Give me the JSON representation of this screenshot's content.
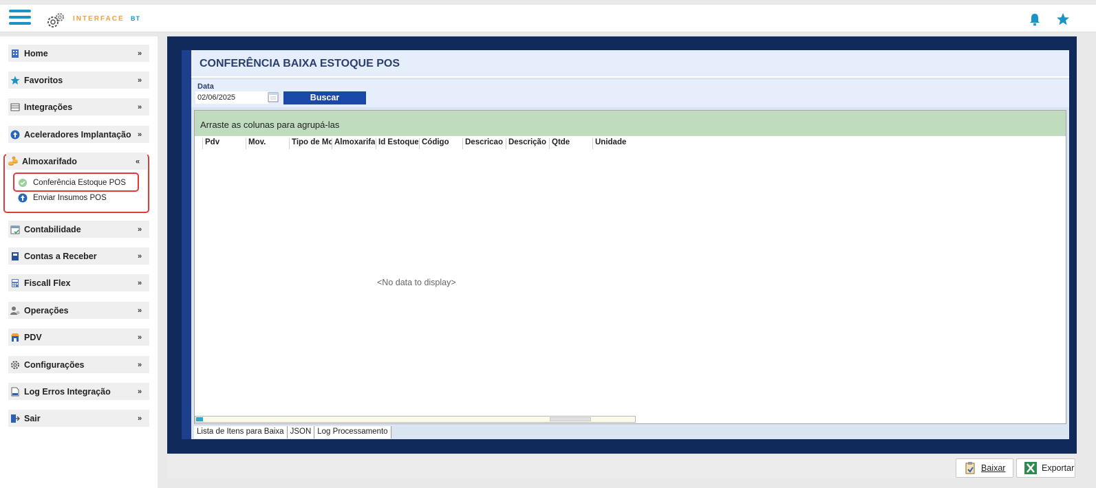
{
  "app": {
    "logo_text": "INTERFACE",
    "logo_suffix": "BT"
  },
  "sidebar": {
    "items": [
      {
        "label": "Home",
        "icon": "building-icon",
        "chevron": "double-chevron-down"
      },
      {
        "label": "Favoritos",
        "icon": "star-icon",
        "chevron": "double-chevron-down"
      },
      {
        "label": "Integrações",
        "icon": "table-icon",
        "chevron": "double-chevron-down"
      },
      {
        "label": "Aceleradores Implantação",
        "icon": "arrow-up-circle-icon",
        "chevron": "double-chevron-down"
      },
      {
        "label": "Almoxarifado",
        "icon": "coins-icon",
        "chevron": "double-chevron-up",
        "expanded": true,
        "children": [
          {
            "label": "Conferência Estoque POS",
            "icon": "check-circle-icon",
            "selected": true
          },
          {
            "label": "Enviar Insumos POS",
            "icon": "arrow-up-circle-icon"
          }
        ]
      },
      {
        "label": "Contabilidade",
        "icon": "calendar-check-icon",
        "chevron": "double-chevron-down"
      },
      {
        "label": "Contas a Receber",
        "icon": "book-icon",
        "chevron": "double-chevron-down"
      },
      {
        "label": "Fiscall Flex",
        "icon": "calculator-icon",
        "chevron": "double-chevron-down"
      },
      {
        "label": "Operações",
        "icon": "user-gear-icon",
        "chevron": "double-chevron-down"
      },
      {
        "label": "PDV",
        "icon": "store-icon",
        "chevron": "double-chevron-down"
      },
      {
        "label": "Configurações",
        "icon": "gear-icon",
        "chevron": "double-chevron-down"
      },
      {
        "label": "Log Erros Integração",
        "icon": "log-file-icon",
        "chevron": "double-chevron-down"
      },
      {
        "label": "Sair",
        "icon": "exit-icon",
        "chevron": "double-chevron-down"
      }
    ]
  },
  "main": {
    "title": "CONFERÊNCIA BAIXA ESTOQUE POS",
    "filter": {
      "date_label": "Data",
      "date_value": "02/06/2025",
      "search_label": "Buscar"
    },
    "grid": {
      "group_hint": "Arraste as colunas para agrupá-las",
      "columns": [
        "Pdv",
        "Mov.",
        "Tipo de Mo",
        "Almoxarifa",
        "Id Estoque",
        "Código",
        "Descricao",
        "Descrição",
        "Qtde",
        "Unidade"
      ],
      "empty_text": "<No data to display>"
    },
    "tabs": [
      "Lista de Itens para Baixa",
      "JSON",
      "Log Processamento"
    ]
  },
  "actions": {
    "baixar_label": "Baixar",
    "exportar_label": "Exportar"
  },
  "colors": {
    "accent": "#1c93c4",
    "header_dark": "#112a5c",
    "button_blue": "#1a48a8",
    "group_green": "#bfdcbe",
    "highlight_red": "#e23a3a"
  }
}
